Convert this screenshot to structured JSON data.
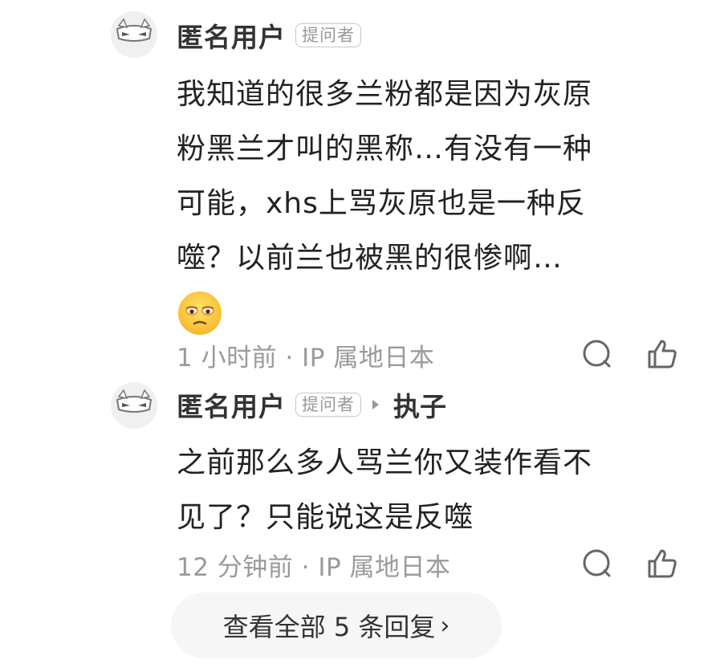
{
  "replies": [
    {
      "username": "匿名用户",
      "badge": "提问者",
      "lines": [
        "我知道的很多兰粉都是因为灰原",
        "粉黑兰才叫的黑称…有没有一种",
        "可能，xhs上骂灰原也是一种反",
        "噬？以前兰也被黑的很惨啊…"
      ],
      "emoji": "tired-face-emoji",
      "meta": "1 小时前 · IP 属地日本"
    },
    {
      "username": "匿名用户",
      "badge": "提问者",
      "reply_to": "执子",
      "lines": [
        "之前那么多人骂兰你又装作看不",
        "见了？只能说这是反噬"
      ],
      "meta": "12 分钟前 · IP 属地日本"
    }
  ],
  "view_all": {
    "label": "查看全部 5 条回复",
    "chevron": "›"
  },
  "icons": {
    "comment": "comment-bubble-icon",
    "like": "thumbs-up-icon",
    "avatar": "anonymous-mask-avatar"
  },
  "colors": {
    "text": "#222222",
    "meta": "#9a9a9a",
    "badge_border": "#c8c8c8",
    "button_bg": "#f6f6f6"
  }
}
